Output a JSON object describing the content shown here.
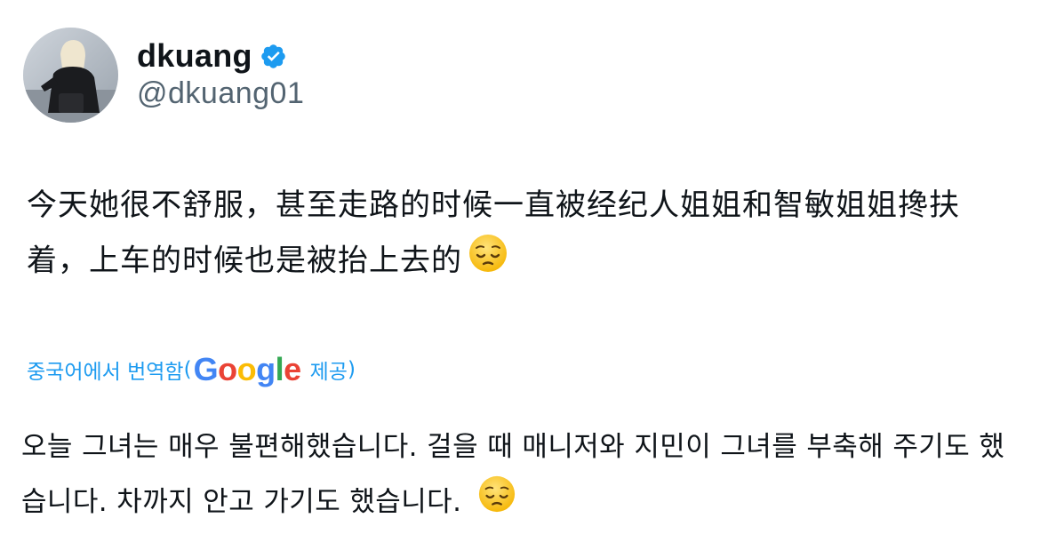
{
  "author": {
    "display_name": "dkuang",
    "handle": "@dkuang01",
    "verified": true,
    "verified_icon": "verified-badge-icon",
    "verified_color": "#1d9bf0"
  },
  "tweet": {
    "text": "今天她很不舒服，甚至走路的时候一直被经纪人姐姐和智敏姐姐搀扶着，上车的时候也是被抬上去的",
    "emoji": "pensive-face-emoji"
  },
  "translation": {
    "label": "중국어에서 번역함",
    "open_paren": "(",
    "provider": "Google",
    "provider_suffix": "제공",
    "close_paren": ")",
    "text": "오늘 그녀는 매우 불편해했습니다. 걸을 때 매니저와 지민이 그녀를 부축해 주기도 했습니다. 차까지 안고 가기도 했습니다.",
    "link_color": "#1d9bf0"
  }
}
